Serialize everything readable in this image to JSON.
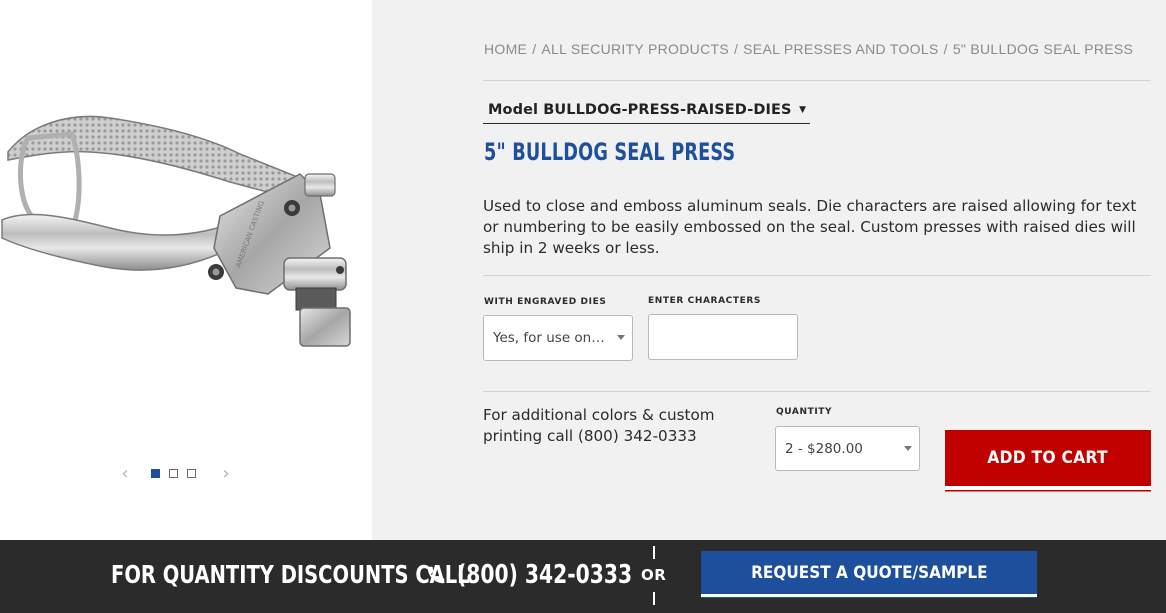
{
  "gallery": {
    "image_alt": "5\" Bulldog Seal Press",
    "image_label": "AMERICAN CASTING",
    "prev_icon": "chevron-left-icon",
    "next_icon": "chevron-right-icon",
    "prev_glyph": "‹",
    "next_glyph": "›",
    "dots": [
      {
        "active": true
      },
      {
        "active": false
      },
      {
        "active": false
      }
    ]
  },
  "breadcrumb": {
    "items": [
      "HOME",
      "ALL SECURITY PRODUCTS",
      "SEAL PRESSES AND TOOLS",
      "5\" BULLDOG SEAL PRESS"
    ],
    "separator": "/"
  },
  "product": {
    "model_select": {
      "value": "Model BULLDOG-PRESS-RAISED-DIES",
      "caret": "▼"
    },
    "title": "5\" BULLDOG SEAL PRESS",
    "description": "Used to close and emboss aluminum seals. Die characters are raised allowing for text or numbering to be easily embossed on the seal. Custom presses with raised dies will ship in 2 weeks or less."
  },
  "options": {
    "engraved_dies": {
      "label": "WITH ENGRAVED DIES",
      "value": "Yes, for use on A..."
    },
    "characters": {
      "label": "ENTER CHARACTERS",
      "value": ""
    }
  },
  "purchase": {
    "custom_note": "For additional colors & custom printing call (800) 342-0333",
    "quantity": {
      "label": "QUANTITY",
      "value": "2 - $280.00"
    },
    "add_to_cart_label": "ADD TO CART"
  },
  "footer": {
    "discount_text": "FOR QUANTITY DISCOUNTS CALL",
    "phone_icon": "phone-icon",
    "phone_number": "(800) 342-0333",
    "or_text": "OR",
    "quote_button_label": "REQUEST A QUOTE/SAMPLE"
  },
  "colors": {
    "brand_blue": "#1d4f9c",
    "cart_red": "#c10000",
    "footer_dark": "#2b2b2b",
    "panel_gray": "#f1f1f1"
  }
}
